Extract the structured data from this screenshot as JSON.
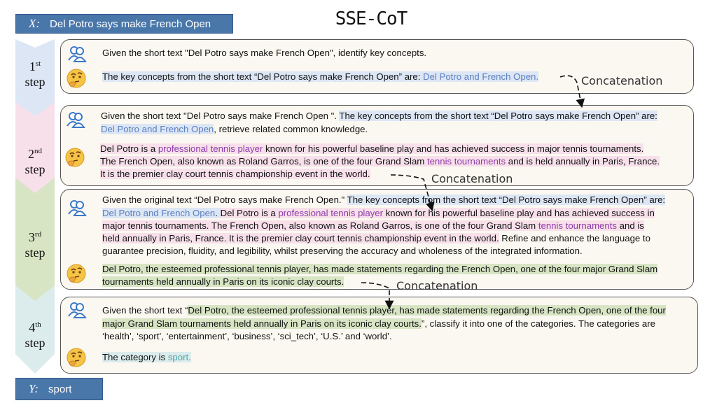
{
  "title": "SSE-CoT",
  "input": {
    "symbol": "X:",
    "text": "Del Potro says make French Open"
  },
  "output": {
    "symbol": "Y:",
    "text": "sport"
  },
  "steps": [
    {
      "num": "1",
      "sup": "st",
      "word": "step",
      "user_text": "Given the short text \"Del Potro says make French Open\", identify key concepts.",
      "answer_pre": "The key concepts from the short text “Del Potro says make French Open” are: ",
      "answer_concepts": "Del Potro and French Open."
    },
    {
      "num": "2",
      "sup": "nd",
      "word": "step",
      "user_a": "Given the short text \"Del Potro says make French Open \". ",
      "user_b": "The key concepts from the short text “Del Potro says make French Open” are:",
      "user_c": "Del Potro and French Open",
      "user_d": ", retrieve related common knowledge.",
      "ans1_a": "Del Potro is a ",
      "ans1_b": "professional tennis player",
      "ans1_c": " known for his powerful baseline play and has achieved success in major tennis tournaments.",
      "ans2_a": "The French Open, also known as Roland Garros, is one of the four Grand Slam ",
      "ans2_b": "tennis tournaments",
      "ans2_c": " and is held annually in Paris, France.",
      "ans3": "It is the premier clay court tennis championship event in the world."
    },
    {
      "num": "3",
      "sup": "rd",
      "word": "step",
      "u1_a": "Given the original text “Del Potro says make French Open.\" ",
      "u1_b": "The key concepts from the short text “Del Potro says make French Open” are:",
      "u2_a": "Del Potro and French Open",
      "u2_b": ". ",
      "u2_c": "Del Potro is a ",
      "u2_d": "professional tennis player",
      "u2_e": " known for his powerful baseline play and has achieved success in",
      "u3_a": "major tennis tournaments. The French Open, also known as Roland Garros, is one of the four Grand Slam ",
      "u3_b": "tennis tournaments",
      "u3_c": " and is",
      "u4": "held annually in Paris, France. It is the premier clay court tennis championship event in the world.",
      "u4_b": " Refine and enhance the language to",
      "u5": "guarantee precision, fluidity, and legibility, whilst preserving the accuracy and wholeness of the integrated information.",
      "a1": "Del Potro, the esteemed professional tennis player, has made statements regarding the French Open, one of the four major Grand Slam",
      "a2": "tournaments held annually in Paris on its iconic clay courts."
    },
    {
      "num": "4",
      "sup": "th",
      "word": "step",
      "u1_a": "Given the short text “",
      "u1_b": "Del Potro, the esteemed professional tennis player, has made statements regarding the French Open, one of the four",
      "u2_a": "major Grand Slam tournaments held annually in Paris on its iconic clay courts.",
      "u2_b": "”, classify it into one of the categories. The categories are",
      "u3": "‘health’, ‘sport’, ‘entertainment’, ‘business’, ‘sci_tech’, ‘U.S.’ and  ‘world’.",
      "ans_a": "The category is ",
      "ans_b": "sport."
    }
  ],
  "concat_label": "Concatenation",
  "colors": {
    "blue_box": "#4a77aa",
    "step1": "#dce6f4",
    "step2": "#f8e0ea",
    "step3": "#d7e5c4",
    "step4": "#dcecec",
    "panel": "#fbf8f1"
  },
  "icons": {
    "user": "user-group-icon",
    "model": "thinking-face-icon"
  }
}
